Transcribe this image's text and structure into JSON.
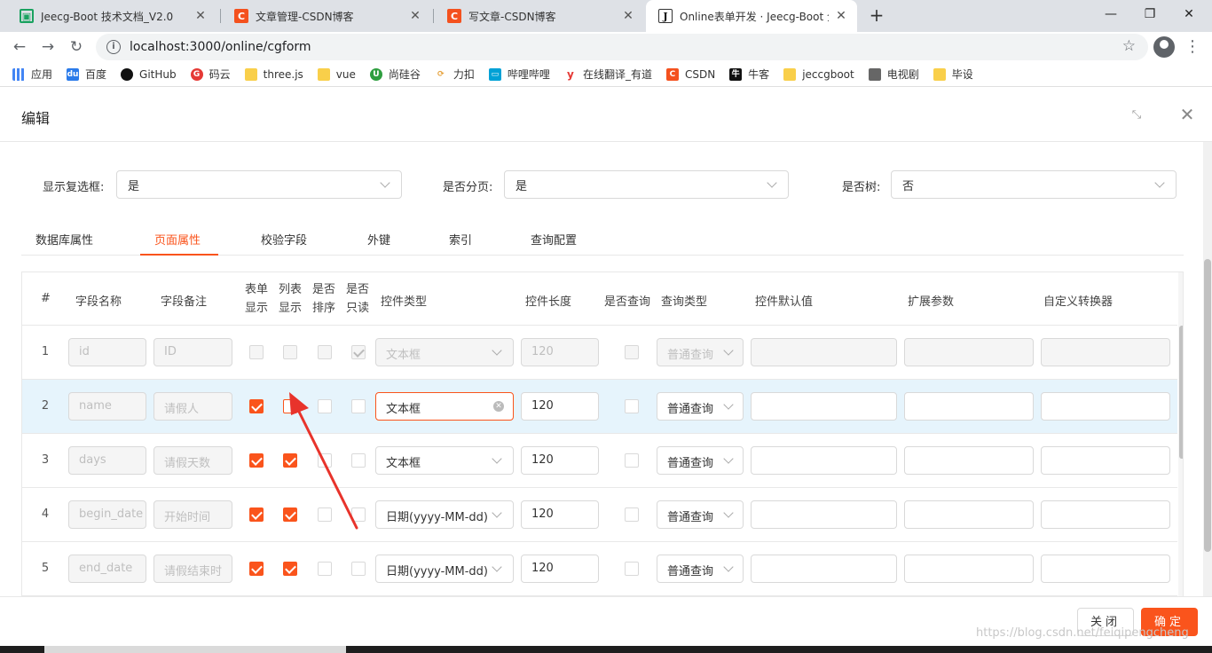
{
  "browser": {
    "tabs": [
      {
        "title": "Jeecg-Boot 技术文档_V2.0",
        "icon": "jeecg-icon"
      },
      {
        "title": "文章管理-CSDN博客",
        "icon": "csdn-icon"
      },
      {
        "title": "写文章-CSDN博客",
        "icon": "csdn-icon"
      },
      {
        "title": "Online表单开发 · Jeecg-Boot 企",
        "icon": "j-icon"
      }
    ],
    "url": "localhost:3000/online/cgform",
    "bookmarks": [
      "应用",
      "百度",
      "GitHub",
      "码云",
      "three.js",
      "vue",
      "尚硅谷",
      "力扣",
      "哔哩哔哩",
      "在线翻译_有道",
      "CSDN",
      "牛客",
      "jeccgboot",
      "电视剧",
      "毕设"
    ]
  },
  "modal": {
    "title": "编辑",
    "form": {
      "show_checkbox_label": "显示复选框:",
      "show_checkbox_value": "是",
      "paging_label": "是否分页:",
      "paging_value": "是",
      "tree_label": "是否树:",
      "tree_value": "否"
    },
    "tabs": [
      "数据库属性",
      "页面属性",
      "校验字段",
      "外键",
      "索引",
      "查询配置"
    ],
    "active_tab": "页面属性",
    "columns": {
      "index": "#",
      "field_name": "字段名称",
      "field_note": "字段备注",
      "form_show_1": "表单",
      "form_show_2": "显示",
      "list_show_1": "列表",
      "list_show_2": "显示",
      "sortable_1": "是否",
      "sortable_2": "排序",
      "readonly_1": "是否",
      "readonly_2": "只读",
      "control_type": "控件类型",
      "control_length": "控件长度",
      "is_query": "是否查询",
      "query_type": "查询类型",
      "default_value": "控件默认值",
      "ext_params": "扩展参数",
      "converter": "自定义转换器"
    },
    "rows": [
      {
        "idx": "1",
        "name": "id",
        "note": "ID",
        "form_show": false,
        "list_show": false,
        "sortable": false,
        "readonly": true,
        "control": "文本框",
        "length": "120",
        "is_query": false,
        "query": "普通查询",
        "disabled": true,
        "selected": false
      },
      {
        "idx": "2",
        "name": "name",
        "note": "请假人",
        "form_show": true,
        "list_show": false,
        "sortable": false,
        "readonly": false,
        "control": "文本框",
        "length": "120",
        "is_query": false,
        "query": "普通查询",
        "disabled": false,
        "selected": true
      },
      {
        "idx": "3",
        "name": "days",
        "note": "请假天数",
        "form_show": true,
        "list_show": true,
        "sortable": false,
        "readonly": false,
        "control": "文本框",
        "length": "120",
        "is_query": false,
        "query": "普通查询",
        "disabled": false,
        "selected": false
      },
      {
        "idx": "4",
        "name": "begin_date",
        "note": "开始时间",
        "form_show": true,
        "list_show": true,
        "sortable": false,
        "readonly": false,
        "control": "日期(yyyy-MM-dd)",
        "length": "120",
        "is_query": false,
        "query": "普通查询",
        "disabled": false,
        "selected": false
      },
      {
        "idx": "5",
        "name": "end_date",
        "note": "请假结束时",
        "form_show": true,
        "list_show": true,
        "sortable": false,
        "readonly": false,
        "control": "日期(yyyy-MM-dd)",
        "length": "120",
        "is_query": false,
        "query": "普通查询",
        "disabled": false,
        "selected": false
      }
    ],
    "footer": {
      "close_label": "关闭",
      "ok_label": "确定"
    },
    "watermark": "https://blog.csdn.net/feiqipengcheng"
  },
  "colors": {
    "accent": "#fa541c",
    "selected_row": "#e6f4fc",
    "annotation_arrow": "#e8332b"
  }
}
